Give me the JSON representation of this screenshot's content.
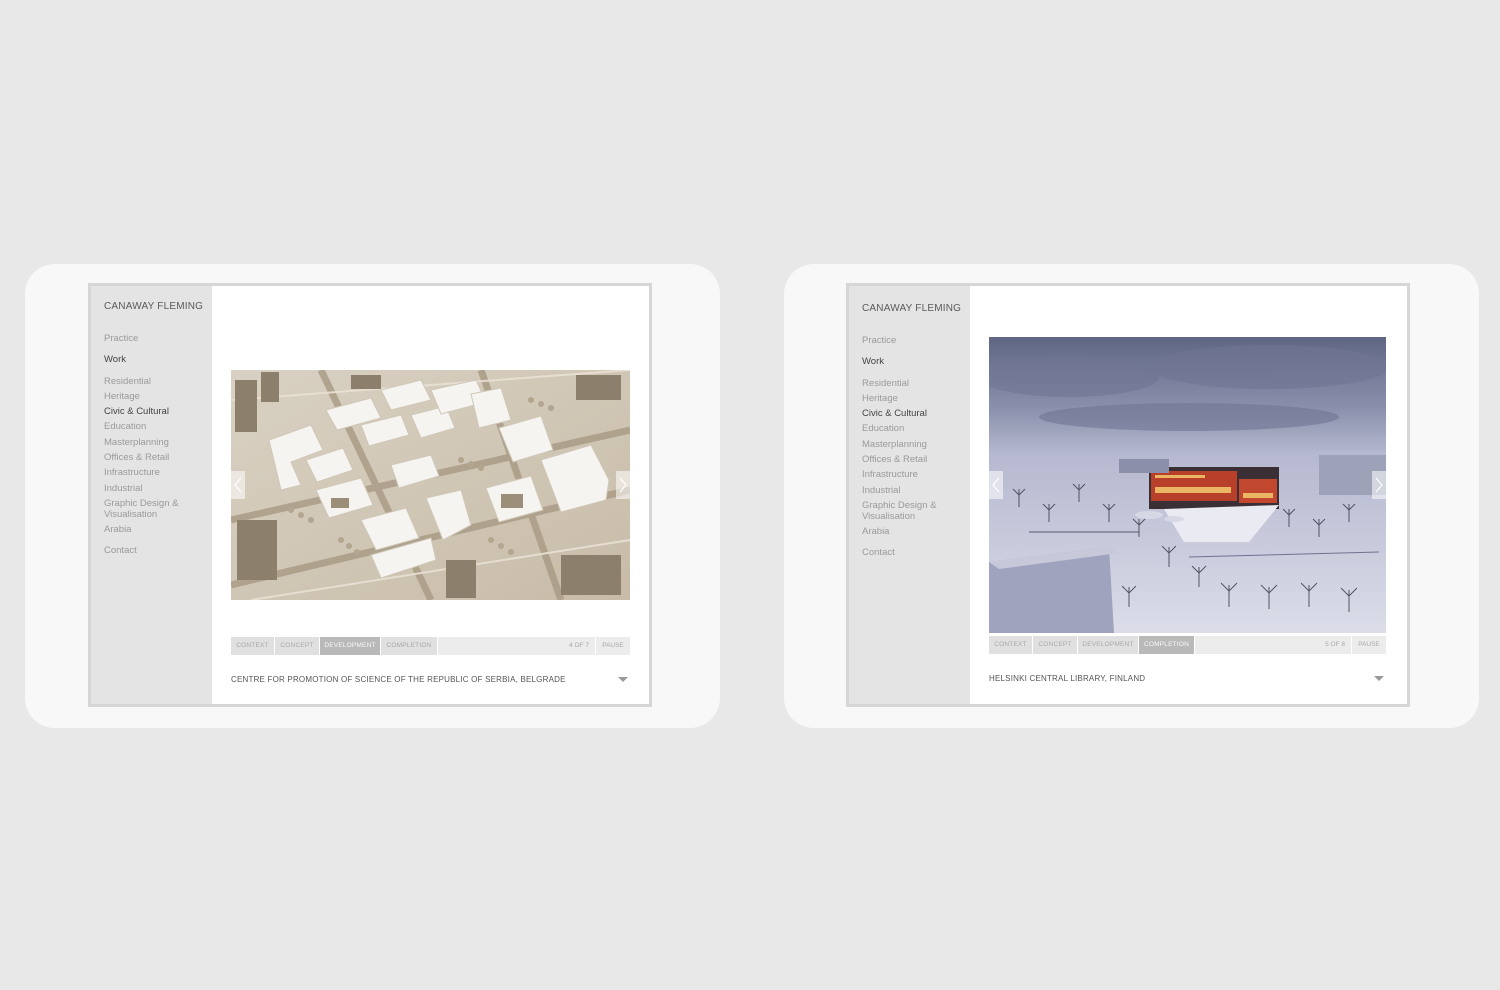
{
  "devices": [
    {
      "brand": "CANAWAY FLEMING",
      "nav": {
        "main": [
          "Practice",
          "Work"
        ],
        "categories": [
          "Residential",
          "Heritage",
          "Civic & Cultural",
          "Education",
          "Masterplanning",
          "Offices & Retail",
          "Infrastructure",
          "Industrial",
          "Graphic Design & Visualisation",
          "Arabia"
        ],
        "contact": "Contact"
      },
      "active_main": "Work",
      "active_category": "Civic & Cultural",
      "slideshow": {
        "tabs": [
          "CONTEXT",
          "CONCEPT",
          "DEVELOPMENT",
          "COMPLETION"
        ],
        "active_tab": "DEVELOPMENT",
        "counter": "4 OF 7",
        "pause_label": "PAUSE"
      },
      "caption": "CENTRE FOR PROMOTION OF SCIENCE OF THE REPUBLIC OF SERBIA, BELGRADE",
      "image": "white architectural model of urban blocks"
    },
    {
      "brand": "CANAWAY FLEMING",
      "nav": {
        "main": [
          "Practice",
          "Work"
        ],
        "categories": [
          "Residential",
          "Heritage",
          "Civic & Cultural",
          "Education",
          "Masterplanning",
          "Offices & Retail",
          "Infrastructure",
          "Industrial",
          "Graphic Design & Visualisation",
          "Arabia"
        ],
        "contact": "Contact"
      },
      "active_main": "Work",
      "active_category": "Civic & Cultural",
      "slideshow": {
        "tabs": [
          "CONTEXT",
          "CONCEPT",
          "DEVELOPMENT",
          "COMPLETION"
        ],
        "active_tab": "COMPLETION",
        "counter": "5 OF 8",
        "pause_label": "PAUSE"
      },
      "caption": "HELSINKI CENTRAL LIBRARY, FINLAND",
      "image": "winter rendering of library with red facade in snowy park"
    }
  ],
  "icons": {
    "prev": "chevron-left-icon",
    "next": "chevron-right-icon",
    "caption_toggle": "caret-down-icon"
  }
}
